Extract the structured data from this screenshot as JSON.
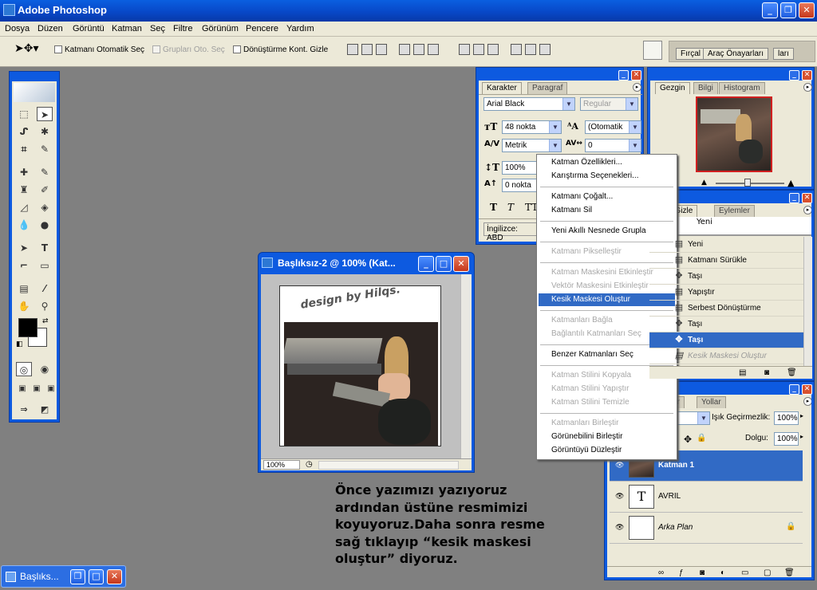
{
  "app": {
    "title": "Adobe Photoshop"
  },
  "menu": [
    "Dosya",
    "Düzen",
    "Görüntü",
    "Katman",
    "Seç",
    "Filtre",
    "Görünüm",
    "Pencere",
    "Yardım"
  ],
  "options": {
    "auto_select": "Katmanı Otomatik Seç",
    "group_select": "Grupları Oto. Seç",
    "transform": "Dönüştürme Kont. Gizle",
    "well_tab1": "Fırçal",
    "well_tab2": "Araç Önayarları",
    "well_tab3": "ları"
  },
  "character": {
    "tabs": [
      "Karakter",
      "Paragraf"
    ],
    "font_family": "Arial Black",
    "font_style": "Regular",
    "size": "48 nokta",
    "leading": "(Otomatik",
    "kerning": "Metrik",
    "tracking": "0",
    "vscale": "100%",
    "baseline": "0 nokta",
    "language": "İngilizce: ABD"
  },
  "navigator": {
    "tabs": [
      "Gezgin",
      "Bilgi",
      "Histogram"
    ]
  },
  "history": {
    "tabs": [
      "mişi Gizle",
      "Eylemler"
    ],
    "snapshot": "Yeni",
    "items": [
      "Yeni",
      "Katmanı Sürükle",
      "Taşı",
      "Yapıştır",
      "Serbest Dönüştürme",
      "Taşı",
      "Taşı",
      "Kesik Maskesi Oluştur"
    ]
  },
  "layers": {
    "tabs": [
      "allar",
      "Yollar"
    ],
    "opacity_label": "Işık Geçirmezlik:",
    "opacity": "100%",
    "fill_label": "Dolgu:",
    "fill": "100%",
    "rows": [
      {
        "name": "Katman 1"
      },
      {
        "name": "AVRIL",
        "type_icon": "T"
      },
      {
        "name": "Arka Plan"
      }
    ]
  },
  "document": {
    "title": "Başlıksız-2 @ 100% (Kat...",
    "watermark": "design by Hilqs.",
    "zoom": "100%"
  },
  "context_menu": {
    "groups": [
      [
        {
          "label": "Katman Özellikleri...",
          "enabled": true
        },
        {
          "label": "Karıştırma Seçenekleri...",
          "enabled": true
        }
      ],
      [
        {
          "label": "Katmanı Çoğalt...",
          "enabled": true
        },
        {
          "label": "Katmanı Sil",
          "enabled": true
        }
      ],
      [
        {
          "label": "Yeni Akıllı Nesnede Grupla",
          "enabled": true
        }
      ],
      [
        {
          "label": "Katmanı Pikselleştir",
          "enabled": false
        }
      ],
      [
        {
          "label": "Katman Maskesini Etkinleştir",
          "enabled": false
        },
        {
          "label": "Vektör Maskesini Etkinleştir",
          "enabled": false
        },
        {
          "label": "Kesik Maskesi Oluştur",
          "enabled": true,
          "highlighted": true
        }
      ],
      [
        {
          "label": "Katmanları Bağla",
          "enabled": false
        },
        {
          "label": "Bağlantılı Katmanları Seç",
          "enabled": false
        }
      ],
      [
        {
          "label": "Benzer Katmanları Seç",
          "enabled": true
        }
      ],
      [
        {
          "label": "Katman Stilini Kopyala",
          "enabled": false
        },
        {
          "label": "Katman Stilini Yapıştır",
          "enabled": false
        },
        {
          "label": "Katman Stilini Temizle",
          "enabled": false
        }
      ],
      [
        {
          "label": "Katmanları Birleştir",
          "enabled": false
        },
        {
          "label": "Görünebilini Birleştir",
          "enabled": true
        },
        {
          "label": "Görüntüyü Düzleştir",
          "enabled": true
        }
      ]
    ]
  },
  "caption": {
    "lines": [
      "Önce yazımızı yazıyoruz",
      "ardından üstüne resmimizi",
      "koyuyoruz.Daha sonra resme",
      "sağ tıklayıp “kesik maskesi",
      "oluştur” diyoruz."
    ]
  },
  "taskbar": {
    "label": "Başlıks..."
  },
  "colors": {
    "xp_blue": "#0d5ae0",
    "highlight": "#316ac5",
    "panel": "#ece9d8"
  }
}
